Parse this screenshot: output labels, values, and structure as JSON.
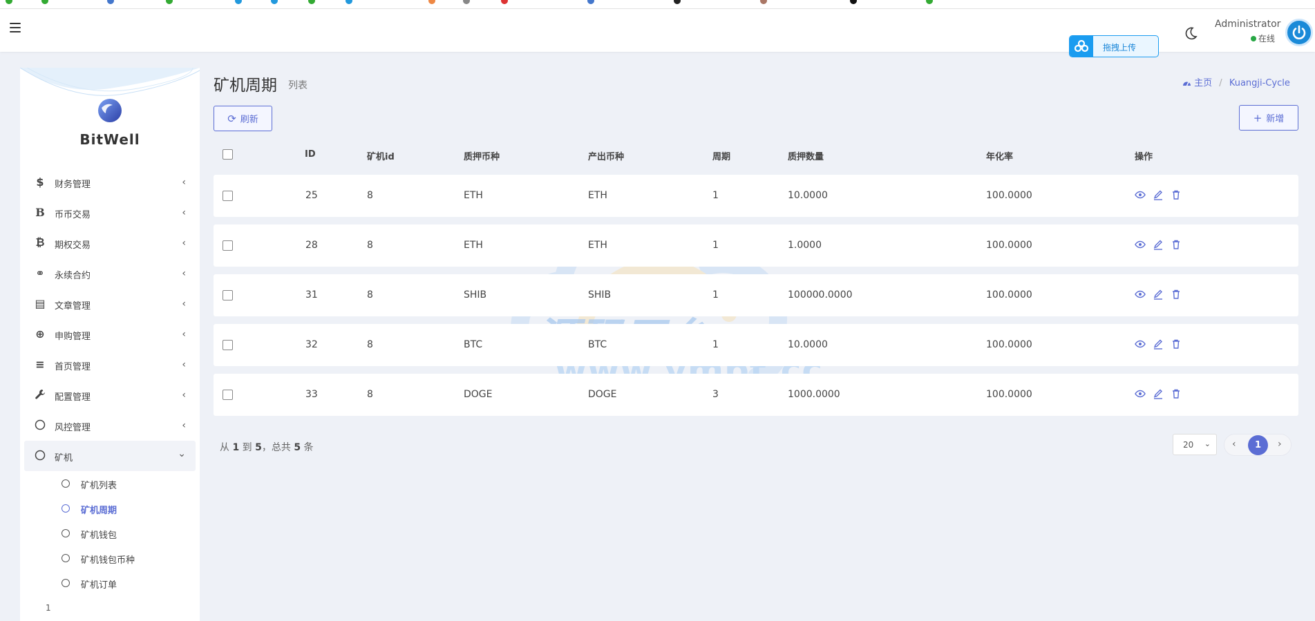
{
  "header": {
    "upload_label": "拖拽上传",
    "admin_name": "Administrator",
    "admin_status": "在线"
  },
  "sidebar": {
    "brand": "BitWell",
    "items": [
      {
        "icon": "dollar-icon",
        "glyph": "$",
        "label": "财务管理"
      },
      {
        "icon": "bold-b-icon",
        "glyph": "B",
        "label": "币币交易"
      },
      {
        "icon": "bitcoin-icon",
        "glyph": "₿",
        "label": "期权交易"
      },
      {
        "icon": "link-icon",
        "glyph": "⚭",
        "label": "永续合约"
      },
      {
        "icon": "newspaper-icon",
        "glyph": "▤",
        "label": "文章管理"
      },
      {
        "icon": "life-ring-icon",
        "glyph": "⊕",
        "label": "申购管理"
      },
      {
        "icon": "list-icon",
        "glyph": "≡",
        "label": "首页管理"
      },
      {
        "icon": "wrench-icon",
        "glyph": "🔧",
        "label": "配置管理"
      },
      {
        "icon": "circle-icon",
        "glyph": "○",
        "label": "风控管理"
      },
      {
        "icon": "circle-icon",
        "glyph": "○",
        "label": "矿机"
      }
    ],
    "submenu": [
      {
        "label": "矿机列表"
      },
      {
        "label": "矿机周期"
      },
      {
        "label": "矿机钱包"
      },
      {
        "label": "矿机钱包币种"
      },
      {
        "label": "矿机订单"
      }
    ],
    "page_number": "1"
  },
  "page": {
    "title": "矿机周期",
    "subtitle": "列表",
    "breadcrumb_home": "主页",
    "breadcrumb_current": "Kuangji-Cycle",
    "refresh_label": "刷新",
    "add_label": "新增"
  },
  "table": {
    "columns": [
      "ID",
      "矿机id",
      "质押币种",
      "产出币种",
      "周期",
      "质押数量",
      "年化率",
      "操作"
    ],
    "rows": [
      {
        "id": "25",
        "kuangji_id": "8",
        "pledge_coin": "ETH",
        "output_coin": "ETH",
        "cycle": "1",
        "pledge_amount": "10.0000",
        "annual_rate": "100.0000"
      },
      {
        "id": "28",
        "kuangji_id": "8",
        "pledge_coin": "ETH",
        "output_coin": "ETH",
        "cycle": "1",
        "pledge_amount": "1.0000",
        "annual_rate": "100.0000"
      },
      {
        "id": "31",
        "kuangji_id": "8",
        "pledge_coin": "SHIB",
        "output_coin": "SHIB",
        "cycle": "1",
        "pledge_amount": "100000.0000",
        "annual_rate": "100.0000"
      },
      {
        "id": "32",
        "kuangji_id": "8",
        "pledge_coin": "BTC",
        "output_coin": "BTC",
        "cycle": "1",
        "pledge_amount": "10.0000",
        "annual_rate": "100.0000"
      },
      {
        "id": "33",
        "kuangji_id": "8",
        "pledge_coin": "DOGE",
        "output_coin": "DOGE",
        "cycle": "3",
        "pledge_amount": "1000.0000",
        "annual_rate": "100.0000"
      }
    ]
  },
  "footer": {
    "summary_prefix": "从",
    "summary_from": "1",
    "summary_to_word": "到",
    "summary_to": "5",
    "summary_total_word": "，总共",
    "summary_total": "5",
    "summary_suffix": "条",
    "per_page": "20",
    "current_page": "1"
  },
  "watermark": {
    "title": "源码平台",
    "url": "www.ympt.cc"
  },
  "colors": {
    "accent": "#5b6dd4",
    "upload_blue": "#1a9cf0",
    "online_green": "#28a745"
  }
}
